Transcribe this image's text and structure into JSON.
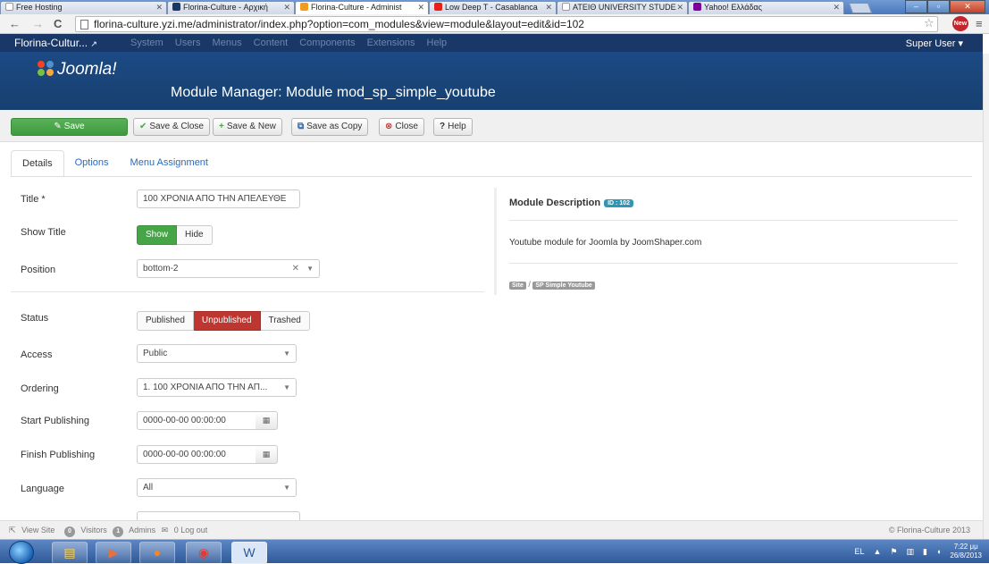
{
  "browser": {
    "tabs": [
      {
        "label": "Free Hosting",
        "icon": "page-icon",
        "color": "#ffffff"
      },
      {
        "label": "Florina-Culture - Αρχική",
        "icon": "joomla-icon",
        "color": "#1a3867"
      },
      {
        "label": "Florina-Culture - Administ",
        "icon": "joomla-icon",
        "color": "#f29b1d"
      },
      {
        "label": "Low Deep T - Casablanca",
        "icon": "youtube-icon",
        "color": "#e62117"
      },
      {
        "label": "ATEIΘ UNIVERSITY STUDE",
        "icon": "page-icon",
        "color": "#ffffff"
      },
      {
        "label": "Yahoo! Ελλάδας",
        "icon": "yahoo-icon",
        "color": "#7b0099"
      }
    ],
    "url": "florina-culture.yzi.me/administrator/index.php?option=com_modules&view=module&layout=edit&id=102",
    "ext_badge": "New"
  },
  "jnav": {
    "brand": "Florina-Cultur...",
    "menu": [
      "System",
      "Users",
      "Menus",
      "Content",
      "Components",
      "Extensions",
      "Help"
    ],
    "user": "Super User ▾"
  },
  "header": {
    "logo": "Joomla!",
    "title": "Module Manager: Module mod_sp_simple_youtube"
  },
  "toolbar": {
    "save": "Save",
    "save_close": "Save & Close",
    "save_new": "Save & New",
    "save_copy": "Save as Copy",
    "close": "Close",
    "help": "Help"
  },
  "tabs": [
    "Details",
    "Options",
    "Menu Assignment"
  ],
  "form": {
    "title_label": "Title *",
    "title_value": "100 ΧΡΟΝΙΑ ΑΠΟ ΤΗΝ ΑΠΕΛΕΥΘΕ",
    "show_title_label": "Show Title",
    "show": "Show",
    "hide": "Hide",
    "position_label": "Position",
    "position_value": "bottom-2",
    "status_label": "Status",
    "published": "Published",
    "unpublished": "Unpublished",
    "trashed": "Trashed",
    "access_label": "Access",
    "access_value": "Public",
    "ordering_label": "Ordering",
    "ordering_value": "1. 100 ΧΡΟΝΙΑ ΑΠΟ ΤΗΝ ΑΠ...",
    "start_label": "Start Publishing",
    "start_value": "0000-00-00 00:00:00",
    "finish_label": "Finish Publishing",
    "finish_value": "0000-00-00 00:00:00",
    "language_label": "Language",
    "language_value": "All"
  },
  "module_info": {
    "heading": "Module Description",
    "id_badge": "ID : 102",
    "description": "Youtube module for Joomla by JoomShaper.com",
    "tag_site": "Site",
    "tag_sep": "/",
    "tag_module": "SP Simple Youtube"
  },
  "status": {
    "view_site": "View Site",
    "visitors_count": "0",
    "visitors": "Visitors",
    "admins_count": "1",
    "admins": "Admins",
    "logout": "0 Log out",
    "copyright": "© Florina-Culture 2013"
  },
  "taskbar": {
    "lang": "EL",
    "time": "7:22 μμ",
    "date": "26/8/2013"
  },
  "colors": {
    "joomla_nav": "#1a3867",
    "joomla_header": "#1d4a85",
    "save_green": "#46a546",
    "unpublished_red": "#bd362f",
    "badge_blue": "#2f96b4"
  }
}
